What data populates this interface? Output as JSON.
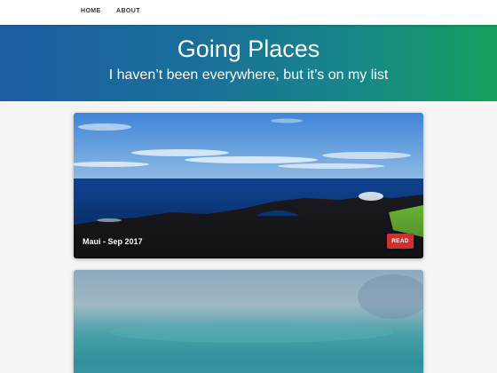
{
  "nav": {
    "home": "HOME",
    "about": "ABOUT"
  },
  "hero": {
    "title": "Going Places",
    "subtitle": "I haven’t been everywhere, but it’s on my list"
  },
  "posts": [
    {
      "caption": "Maui - Sep 2017",
      "button": "READ"
    }
  ]
}
